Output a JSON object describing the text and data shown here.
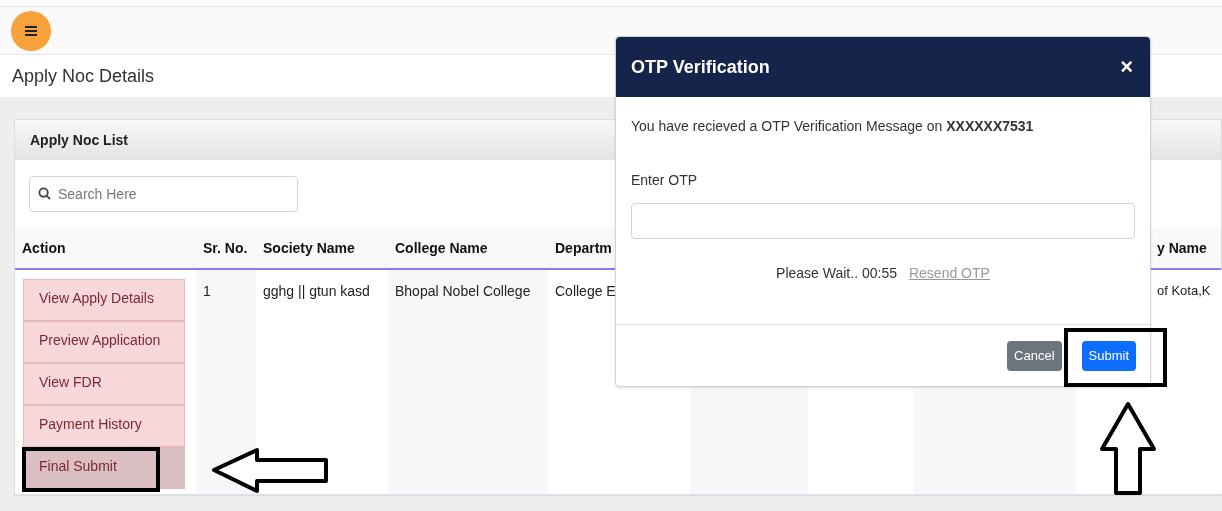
{
  "page_title": "Apply Noc Details",
  "card": {
    "title": "Apply Noc List",
    "search": {
      "placeholder": "Search Here"
    }
  },
  "table": {
    "columns": [
      "Action",
      "Sr. No.",
      "Society Name",
      "College Name",
      "Departm",
      "y Name"
    ],
    "rows": [
      {
        "cells": [
          {
            "kind": "actions",
            "actions": [
              {
                "label": "View Apply Details",
                "selected": false
              },
              {
                "label": "Preview Application",
                "selected": false
              },
              {
                "label": "View FDR",
                "selected": false
              },
              {
                "label": "Payment History",
                "selected": false
              },
              {
                "label": "Final Submit",
                "selected": true
              }
            ]
          },
          {
            "kind": "text",
            "text": "1"
          },
          {
            "kind": "text",
            "text": "gghg || gtun kasd"
          },
          {
            "kind": "text",
            "text": "Bhopal Nobel College"
          },
          {
            "kind": "text",
            "text": "College E"
          },
          {
            "kind": "text",
            "text": "of Kota,K"
          }
        ]
      }
    ]
  },
  "modal": {
    "title": "OTP Verification",
    "close": "×",
    "message": "You have recieved a OTP Verification Message on **XXXXXX7531**",
    "otp_label": "Enter OTP",
    "timer": "Please Wait.. 00:55",
    "resend_link": "Resend OTP",
    "buttons": [
      {
        "label": "Cancel",
        "kind": "secondary"
      },
      {
        "label": "Submit",
        "kind": "primary"
      }
    ]
  }
}
